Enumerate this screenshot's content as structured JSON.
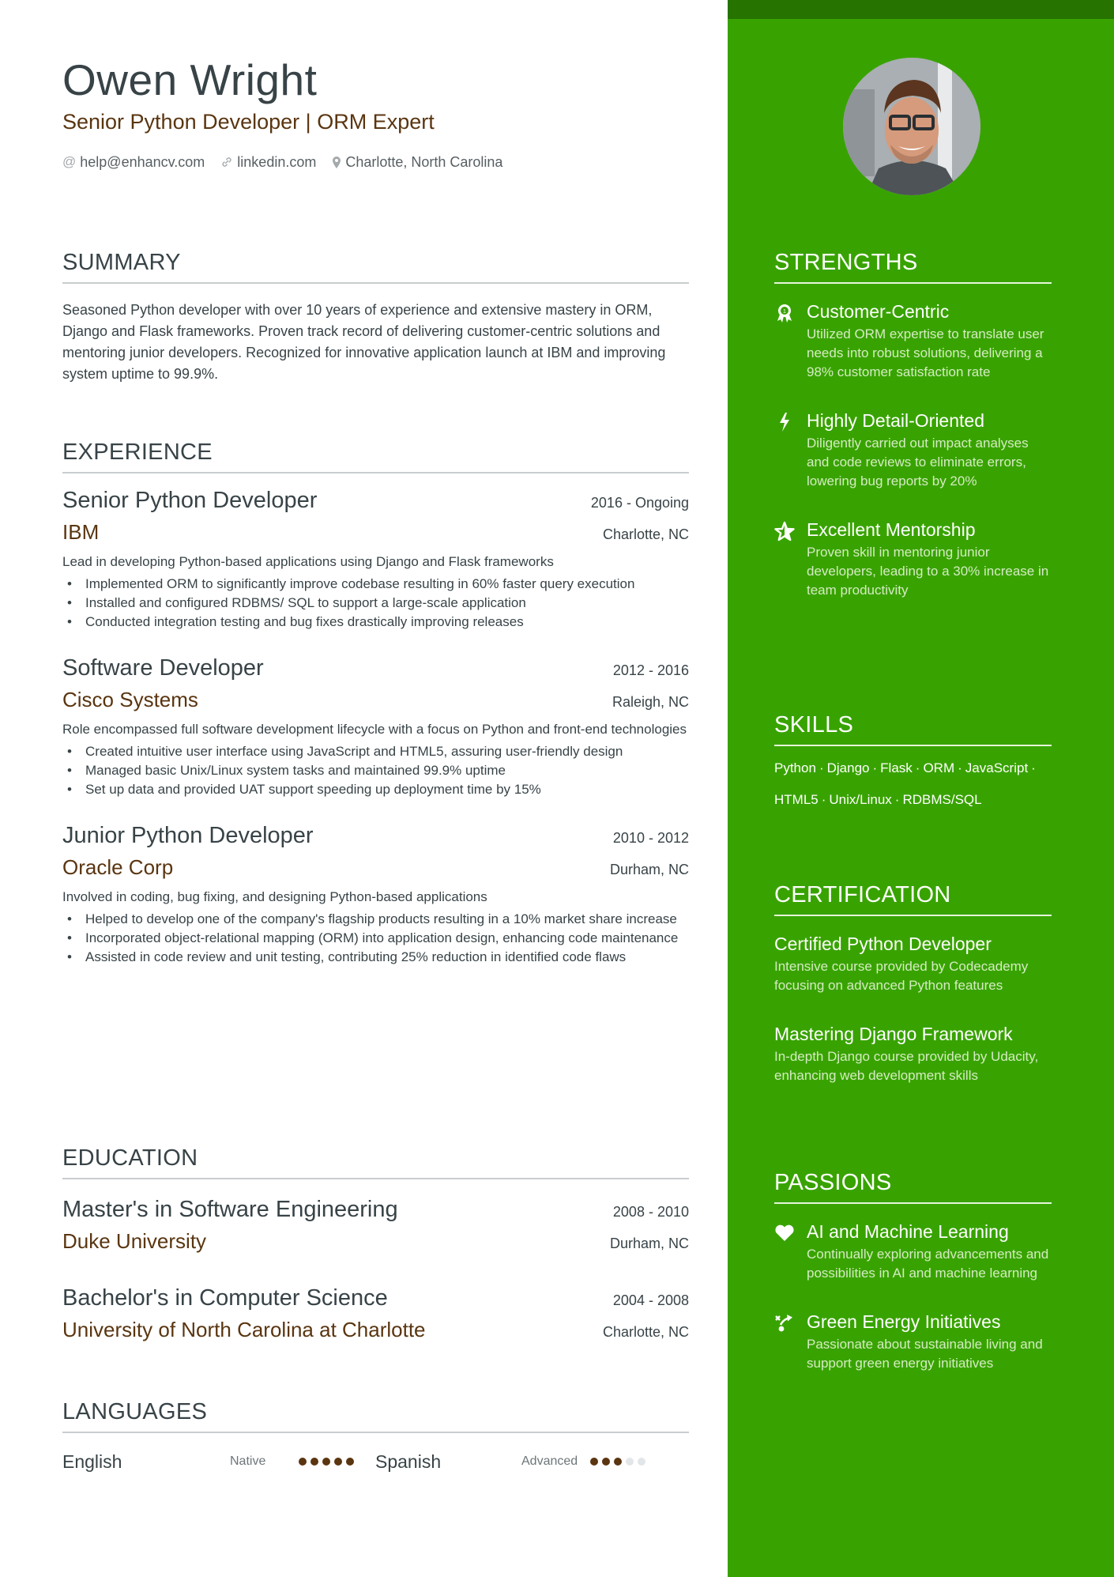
{
  "header": {
    "name": "Owen Wright",
    "headline": "Senior Python Developer | ORM Expert",
    "contacts": [
      {
        "icon": "at-icon",
        "text": "help@enhancv.com"
      },
      {
        "icon": "link-icon",
        "text": "linkedin.com"
      },
      {
        "icon": "location-pin-icon",
        "text": "Charlotte, North Carolina"
      }
    ]
  },
  "summary": {
    "title": "SUMMARY",
    "text": "Seasoned Python developer with over 10 years of experience and extensive mastery in ORM, Django and Flask frameworks. Proven track record of delivering customer-centric solutions and mentoring junior developers. Recognized for innovative application launch at IBM and improving system uptime to 99.9%."
  },
  "experience": {
    "title": "EXPERIENCE",
    "jobs": [
      {
        "title": "Senior Python Developer",
        "dates": "2016 - Ongoing",
        "company": "IBM",
        "location": "Charlotte, NC",
        "description": "Lead in developing Python-based applications using Django and Flask frameworks",
        "bullets": [
          "Implemented ORM to significantly improve codebase resulting in 60% faster query execution",
          "Installed and configured RDBMS/ SQL to support a large-scale application",
          "Conducted integration testing and bug fixes drastically improving releases"
        ]
      },
      {
        "title": "Software Developer",
        "dates": "2012 - 2016",
        "company": "Cisco Systems",
        "location": "Raleigh, NC",
        "description": "Role encompassed full software development lifecycle with a focus on Python and front-end technologies",
        "bullets": [
          "Created intuitive user interface using JavaScript and HTML5, assuring user-friendly design",
          "Managed basic Unix/Linux system tasks and maintained 99.9% uptime",
          "Set up data and provided UAT support speeding up deployment time by 15%"
        ]
      },
      {
        "title": "Junior Python Developer",
        "dates": "2010 - 2012",
        "company": "Oracle Corp",
        "location": "Durham, NC",
        "description": "Involved in coding, bug fixing, and designing Python-based applications",
        "bullets": [
          "Helped to develop one of the company's flagship products resulting in a 10% market share increase",
          "Incorporated object-relational mapping (ORM) into application design, enhancing code maintenance",
          "Assisted in code review and unit testing, contributing 25% reduction in identified code flaws"
        ]
      }
    ]
  },
  "education": {
    "title": "EDUCATION",
    "items": [
      {
        "degree": "Master's in Software Engineering",
        "dates": "2008 - 2010",
        "school": "Duke University",
        "location": "Durham, NC"
      },
      {
        "degree": "Bachelor's in Computer Science",
        "dates": "2004 - 2008",
        "school": "University of North Carolina at Charlotte",
        "location": "Charlotte, NC"
      }
    ]
  },
  "languages": {
    "title": "LANGUAGES",
    "items": [
      {
        "name": "English",
        "level": "Native",
        "rating": 5,
        "max": 5
      },
      {
        "name": "Spanish",
        "level": "Advanced",
        "rating": 3,
        "max": 5
      }
    ]
  },
  "strengths": {
    "title": "STRENGTHS",
    "items": [
      {
        "icon": "award-ribbon-icon",
        "title": "Customer-Centric",
        "description": "Utilized ORM expertise to translate user needs into robust solutions, delivering a 98% customer satisfaction rate"
      },
      {
        "icon": "lightning-bolt-icon",
        "title": "Highly Detail-Oriented",
        "description": "Diligently carried out impact analyses and code reviews to eliminate errors, lowering bug reports by 20%"
      },
      {
        "icon": "star-icon",
        "title": "Excellent Mentorship",
        "description": "Proven skill in mentoring junior developers, leading to a 30% increase in team productivity"
      }
    ]
  },
  "skills": {
    "title": "SKILLS",
    "lines": [
      [
        "Python",
        "Django",
        "Flask",
        "ORM",
        "JavaScript"
      ],
      [
        "HTML5",
        "Unix/Linux",
        "RDBMS/SQL"
      ]
    ],
    "separator": "·"
  },
  "certification": {
    "title": "CERTIFICATION",
    "items": [
      {
        "title": "Certified Python Developer",
        "description": "Intensive course provided by Codecademy focusing on advanced Python features"
      },
      {
        "title": "Mastering Django Framework",
        "description": "In-depth Django course provided by Udacity, enhancing web development skills"
      }
    ]
  },
  "passions": {
    "title": "PASSIONS",
    "items": [
      {
        "icon": "heart-icon",
        "title": "AI and Machine Learning",
        "description": "Continually exploring advancements and possibilities in AI and machine learning"
      },
      {
        "icon": "strategy-arrow-icon",
        "title": "Green Energy Initiatives",
        "description": "Passionate about sustainable living and support green energy initiatives"
      }
    ]
  },
  "colors": {
    "sidebar": "#38a300",
    "sidebar_band": "#267300",
    "accent_brown": "#5a3510",
    "text": "#384347"
  }
}
